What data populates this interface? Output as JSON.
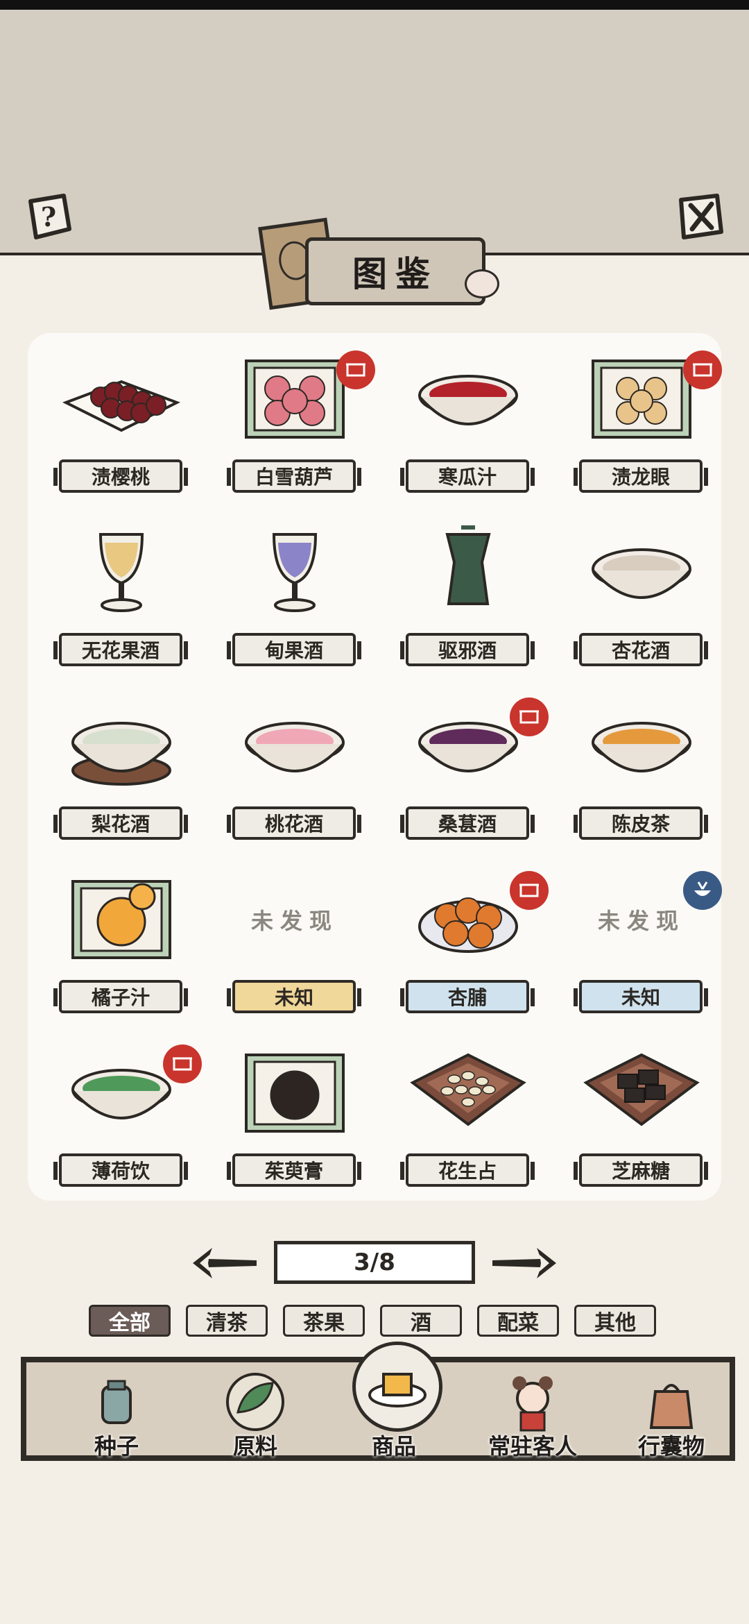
{
  "header": {
    "title": "图鉴",
    "help_icon": "help-icon",
    "close_icon": "close-icon"
  },
  "colors": {
    "top_band": "#d4cdc2",
    "panel": "#fbfaf6",
    "badge_red": "#c9342c",
    "badge_blue": "#3a5a86",
    "label_yellow": "#f0d79a",
    "label_blue": "#cfe2ee",
    "active_filter": "#6b5c58"
  },
  "items": [
    {
      "label": "渍樱桃",
      "art": "cherries-dish",
      "badge": "",
      "variant": "normal",
      "discovered": true
    },
    {
      "label": "白雪葫芦",
      "art": "haws-tray",
      "badge": "red",
      "variant": "normal",
      "discovered": true
    },
    {
      "label": "寒瓜汁",
      "art": "watermelon-juice-bowl",
      "badge": "",
      "variant": "normal",
      "discovered": true
    },
    {
      "label": "渍龙眼",
      "art": "longan-tray",
      "badge": "red",
      "variant": "normal",
      "discovered": true
    },
    {
      "label": "无花果酒",
      "art": "fig-wine-goblet",
      "badge": "",
      "variant": "normal",
      "discovered": true
    },
    {
      "label": "甸果酒",
      "art": "berry-wine-goblet",
      "badge": "",
      "variant": "normal",
      "discovered": true
    },
    {
      "label": "驱邪酒",
      "art": "wine-vessel",
      "badge": "",
      "variant": "normal",
      "discovered": true
    },
    {
      "label": "杏花酒",
      "art": "apricot-wine-bowl",
      "badge": "",
      "variant": "normal",
      "discovered": true
    },
    {
      "label": "梨花酒",
      "art": "pear-wine-cup",
      "badge": "",
      "variant": "normal",
      "discovered": true
    },
    {
      "label": "桃花酒",
      "art": "peach-wine-bowl",
      "badge": "",
      "variant": "normal",
      "discovered": true
    },
    {
      "label": "桑葚酒",
      "art": "mulberry-wine-bowl",
      "badge": "red",
      "variant": "normal",
      "discovered": true
    },
    {
      "label": "陈皮茶",
      "art": "tangerine-tea-bowl",
      "badge": "",
      "variant": "normal",
      "discovered": true
    },
    {
      "label": "橘子汁",
      "art": "orange-juice-tray",
      "badge": "",
      "variant": "normal",
      "discovered": true
    },
    {
      "label": "未知",
      "art": "",
      "badge": "",
      "variant": "yellow",
      "discovered": false,
      "placeholder": "未发现"
    },
    {
      "label": "杏脯",
      "art": "dried-apricot-plate",
      "badge": "red",
      "variant": "blue",
      "discovered": true
    },
    {
      "label": "未知",
      "art": "",
      "badge": "blue",
      "variant": "blue",
      "discovered": false,
      "placeholder": "未发现"
    },
    {
      "label": "薄荷饮",
      "art": "mint-drink-bowl",
      "badge": "red",
      "variant": "normal",
      "discovered": true
    },
    {
      "label": "茱萸膏",
      "art": "dogwood-paste-tray",
      "badge": "",
      "variant": "normal",
      "discovered": true
    },
    {
      "label": "花生占",
      "art": "peanut-tray",
      "badge": "",
      "variant": "normal",
      "discovered": true
    },
    {
      "label": "芝麻糖",
      "art": "sesame-candy-tray",
      "badge": "",
      "variant": "normal",
      "discovered": true
    }
  ],
  "pagination": {
    "current_total": "3/8",
    "prev_icon": "arrow-left-icon",
    "next_icon": "arrow-right-icon"
  },
  "filters": [
    {
      "label": "全部",
      "active": true
    },
    {
      "label": "清茶",
      "active": false
    },
    {
      "label": "茶果",
      "active": false
    },
    {
      "label": "酒",
      "active": false
    },
    {
      "label": "配菜",
      "active": false
    },
    {
      "label": "其他",
      "active": false
    }
  ],
  "bottom_nav": [
    {
      "label": "种子",
      "icon": "seed-jar-icon",
      "active": false
    },
    {
      "label": "原料",
      "icon": "leaf-icon",
      "active": false
    },
    {
      "label": "商品",
      "icon": "goods-plate-icon",
      "active": true
    },
    {
      "label": "常驻客人",
      "icon": "guest-girl-icon",
      "active": false
    },
    {
      "label": "行囊物",
      "icon": "backpack-icon",
      "active": false
    }
  ]
}
